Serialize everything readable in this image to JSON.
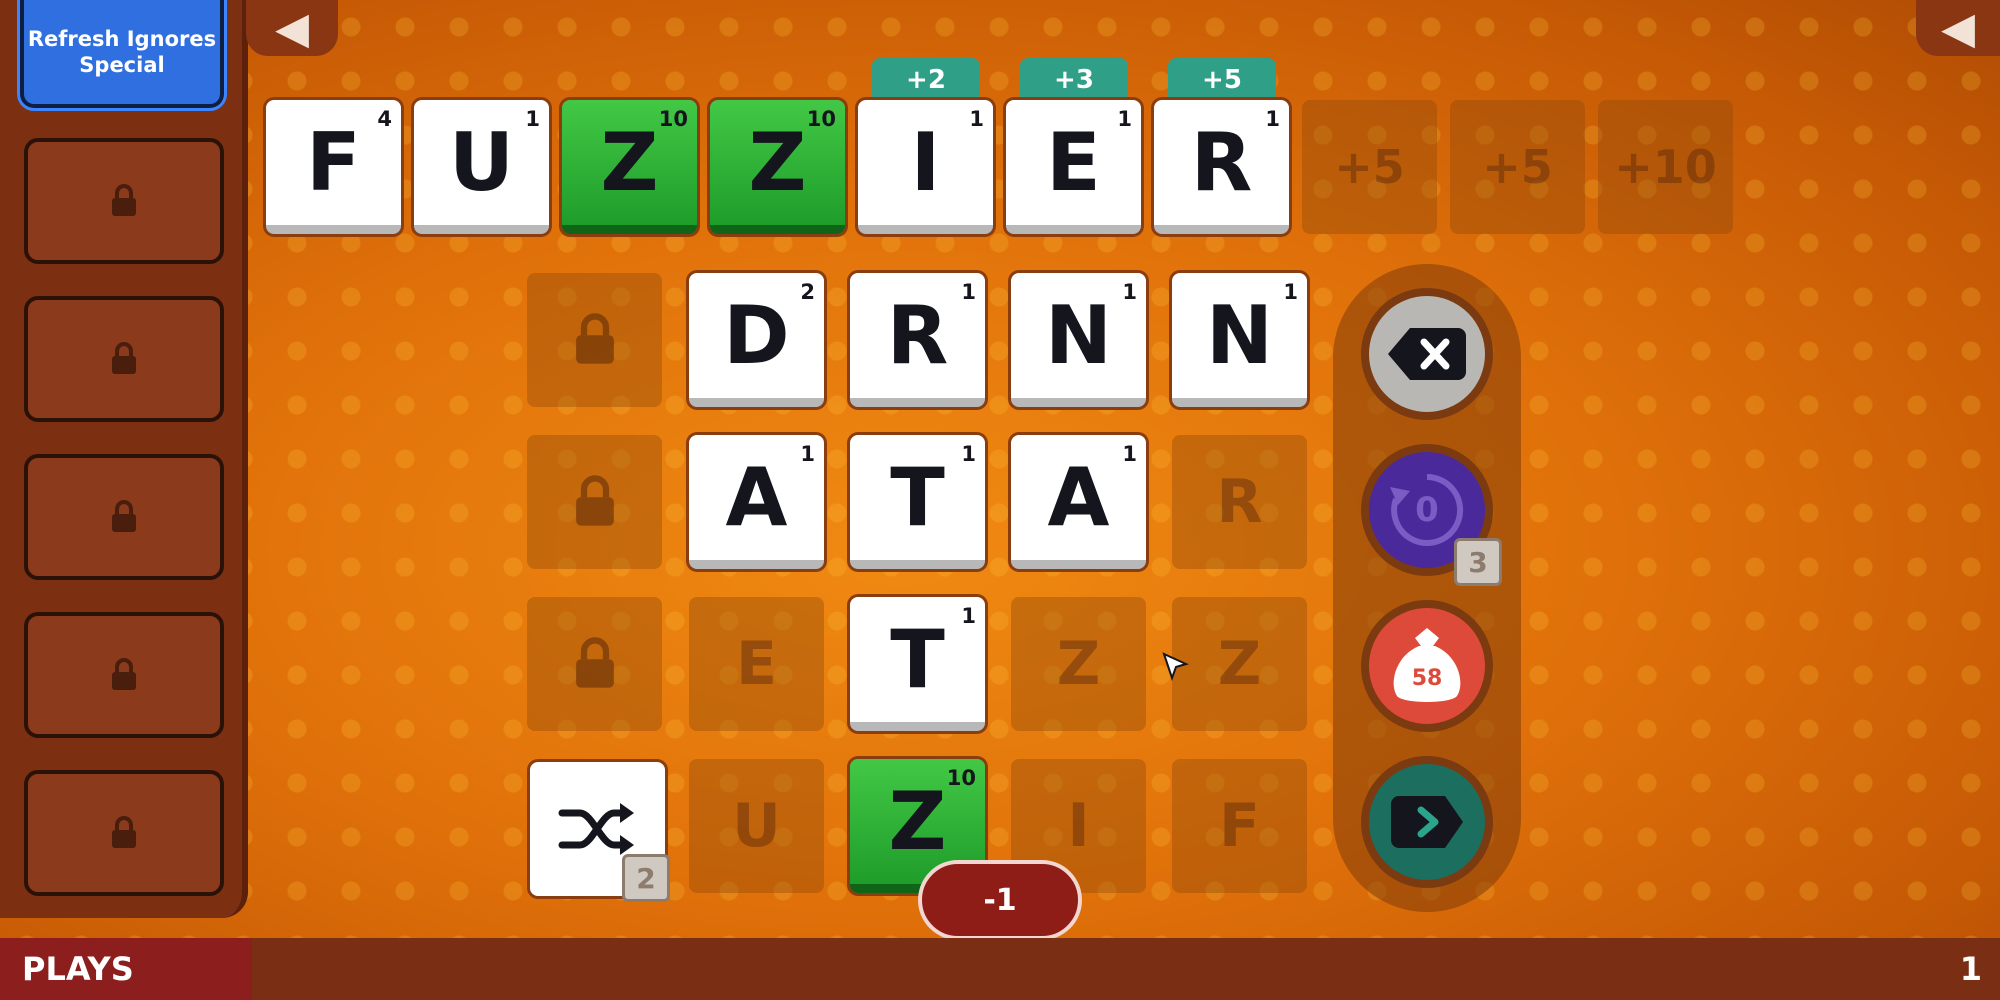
{
  "sidebar": {
    "active_perk_label": "Refresh Ignores Special",
    "locked_slots": 5
  },
  "word": {
    "tiles": [
      {
        "letter": "F",
        "points": "4",
        "special": false
      },
      {
        "letter": "U",
        "points": "1",
        "special": false
      },
      {
        "letter": "Z",
        "points": "10",
        "special": true
      },
      {
        "letter": "Z",
        "points": "10",
        "special": true
      },
      {
        "letter": "I",
        "points": "1",
        "special": false
      },
      {
        "letter": "E",
        "points": "1",
        "special": false
      },
      {
        "letter": "R",
        "points": "1",
        "special": false
      }
    ],
    "bonus_badges": [
      "+2",
      "+3",
      "+5"
    ],
    "empty_bonus_slots": [
      "+5",
      "+5",
      "+10"
    ]
  },
  "rack": {
    "row1": [
      {
        "letter": "D",
        "points": "2"
      },
      {
        "letter": "R",
        "points": "1"
      },
      {
        "letter": "N",
        "points": "1"
      },
      {
        "letter": "N",
        "points": "1"
      }
    ],
    "row2": [
      {
        "letter": "A",
        "points": "1"
      },
      {
        "letter": "T",
        "points": "1"
      },
      {
        "letter": "A",
        "points": "1"
      }
    ],
    "row2_ghost": "R",
    "row3_ghost_left": "E",
    "row3_tile": {
      "letter": "T",
      "points": "1"
    },
    "row3_ghost_mid": "Z",
    "row3_ghost_right": "Z",
    "row4_ghost_left": "U",
    "row4_tile": {
      "letter": "Z",
      "points": "10"
    },
    "row4_ghost_mid": "I",
    "row4_ghost_right": "F"
  },
  "shuffle": {
    "count": "2"
  },
  "controls": {
    "undo_value": "0",
    "undo_count": "3",
    "bag_count": "58"
  },
  "score_delta": "-1",
  "footer": {
    "plays_label": "PLAYS",
    "plays_count": "1"
  },
  "colors": {
    "tile_white": "#ffffff",
    "tile_special_green": "#2fb33a",
    "bonus_teal": "#2f9f88",
    "perk_blue": "#2f6fe0",
    "backspace_gray": "#b9b7b4",
    "undo_purple": "#4a2a9a",
    "bag_red": "#dd4a3a",
    "submit_teal": "#1c6e5e"
  }
}
